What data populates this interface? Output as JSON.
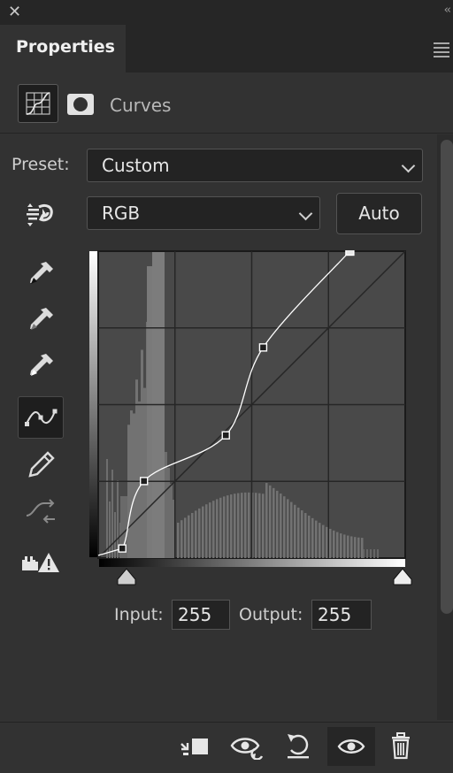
{
  "window": {
    "close_icon": "close-icon",
    "collapse_glyph": "‹‹"
  },
  "tab": {
    "label": "Properties"
  },
  "header": {
    "title": "Curves"
  },
  "preset": {
    "label": "Preset:",
    "value": "Custom"
  },
  "channel": {
    "value": "RGB"
  },
  "auto_button": {
    "label": "Auto"
  },
  "io": {
    "input_label": "Input:",
    "input_value": "255",
    "output_label": "Output:",
    "output_value": "255"
  },
  "curve": {
    "points": [
      [
        0,
        0
      ],
      [
        20,
        8
      ],
      [
        38,
        64
      ],
      [
        106,
        102
      ],
      [
        137,
        175
      ],
      [
        209,
        255
      ]
    ]
  },
  "tools": [
    "on-image-adjust-icon",
    "black-point-eyedropper-icon",
    "gray-point-eyedropper-icon",
    "white-point-eyedropper-icon",
    "edit-points-curve-icon",
    "draw-pencil-icon",
    "smooth-curve-icon",
    "clipping-warning-icon"
  ],
  "colors": {
    "panel": "#323232",
    "dark": "#262626",
    "field": "#232323",
    "accent_text": "#e6e6e6"
  }
}
